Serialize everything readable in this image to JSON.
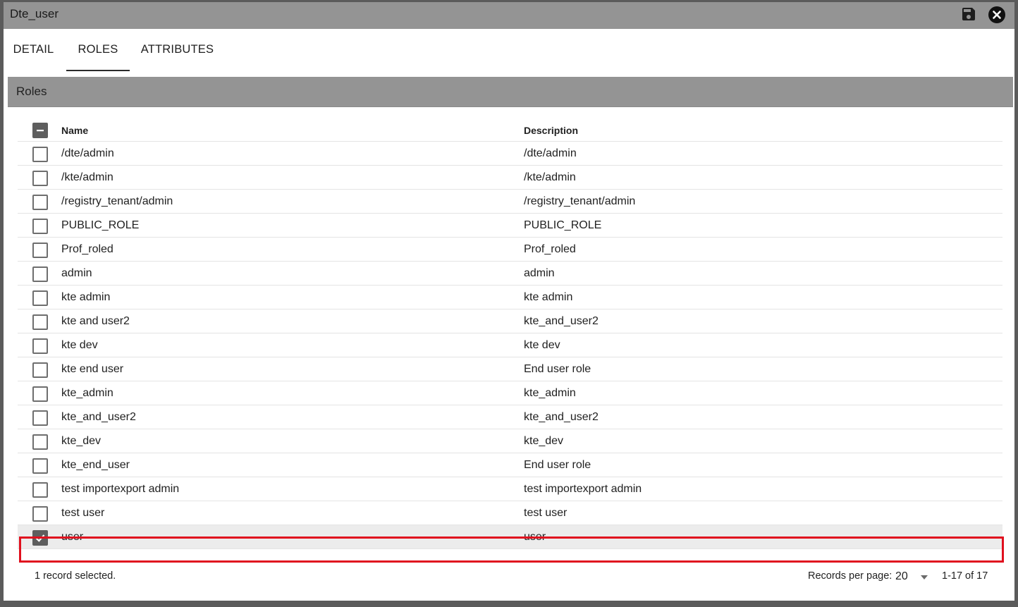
{
  "window": {
    "title": "Dte_user"
  },
  "tabs": [
    {
      "label": "DETAIL",
      "active": false
    },
    {
      "label": "ROLES",
      "active": true
    },
    {
      "label": "ATTRIBUTES",
      "active": false
    }
  ],
  "section": {
    "title": "Roles"
  },
  "table": {
    "columns": {
      "name": "Name",
      "description": "Description"
    },
    "rows": [
      {
        "name": "/dte/admin",
        "description": "/dte/admin",
        "checked": false
      },
      {
        "name": "/kte/admin",
        "description": "/kte/admin",
        "checked": false
      },
      {
        "name": "/registry_tenant/admin",
        "description": "/registry_tenant/admin",
        "checked": false
      },
      {
        "name": "PUBLIC_ROLE",
        "description": "PUBLIC_ROLE",
        "checked": false
      },
      {
        "name": "Prof_roled",
        "description": "Prof_roled",
        "checked": false
      },
      {
        "name": "admin",
        "description": "admin",
        "checked": false
      },
      {
        "name": "kte admin",
        "description": "kte admin",
        "checked": false
      },
      {
        "name": "kte and user2",
        "description": "kte_and_user2",
        "checked": false
      },
      {
        "name": "kte dev",
        "description": "kte dev",
        "checked": false
      },
      {
        "name": "kte end user",
        "description": "End user role",
        "checked": false
      },
      {
        "name": "kte_admin",
        "description": "kte_admin",
        "checked": false
      },
      {
        "name": "kte_and_user2",
        "description": "kte_and_user2",
        "checked": false
      },
      {
        "name": "kte_dev",
        "description": "kte_dev",
        "checked": false
      },
      {
        "name": "kte_end_user",
        "description": "End user role",
        "checked": false
      },
      {
        "name": "test importexport admin",
        "description": "test importexport admin",
        "checked": false
      },
      {
        "name": "test user",
        "description": "test user",
        "checked": false
      },
      {
        "name": "user",
        "description": "user",
        "checked": true
      }
    ]
  },
  "footer": {
    "selection_text": "1 record selected.",
    "records_per_page_label": "Records per page:",
    "records_per_page_value": "20",
    "range_text": "1-17 of 17"
  },
  "colors": {
    "highlight": "#e0101e",
    "header_bg": "#949494"
  },
  "icons": {
    "save": "floppy-disk-icon",
    "close": "close-circle-icon"
  }
}
